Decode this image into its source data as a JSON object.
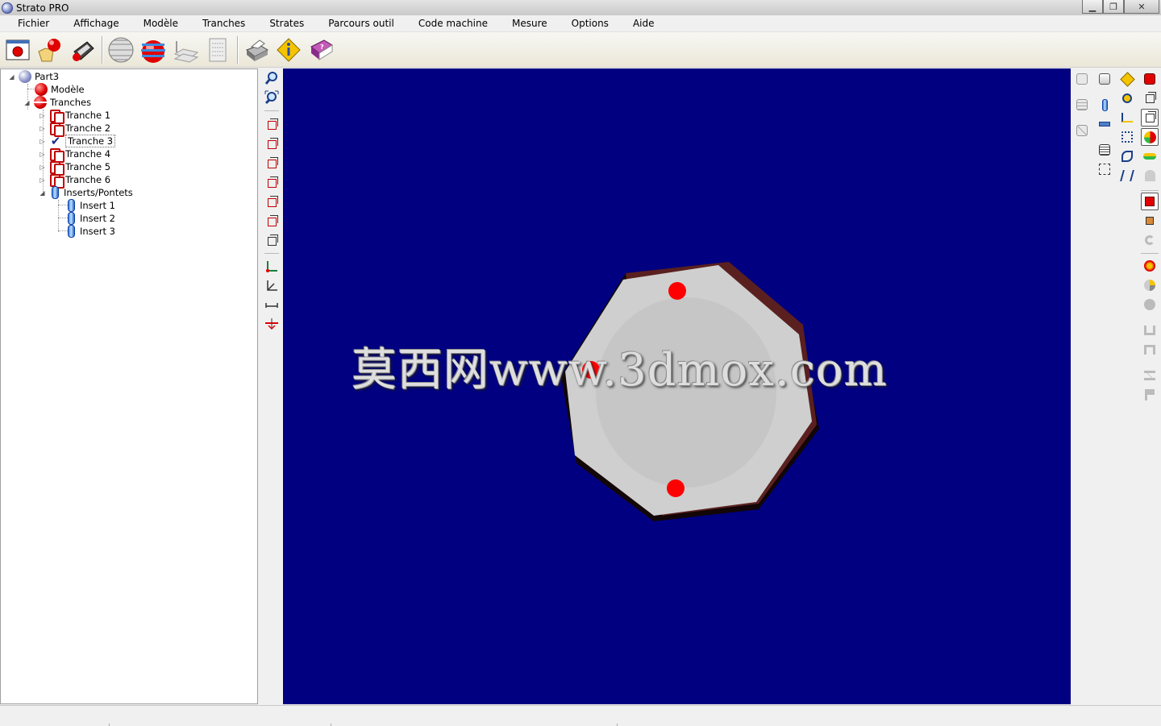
{
  "window": {
    "title": "Strato PRO",
    "controls": [
      "minimize",
      "maximize",
      "close"
    ]
  },
  "menu": [
    "Fichier",
    "Affichage",
    "Modèle",
    "Tranches",
    "Strates",
    "Parcours outil",
    "Code machine",
    "Mesure",
    "Options",
    "Aide"
  ],
  "toolbar": {
    "buttons": [
      "new-part-icon",
      "open-model-icon",
      "save-icon",
      "sphere-wire-icon",
      "stratify-icon",
      "slice-plane-icon",
      "gcode-icon",
      "print-icon",
      "info-icon",
      "help-book-icon"
    ]
  },
  "tree": {
    "root": "Part3",
    "model": "Modèle",
    "slices_folder": "Tranches",
    "slices": [
      "Tranche 1",
      "Tranche 2",
      "Tranche 3",
      "Tranche 4",
      "Tranche 5",
      "Tranche 6"
    ],
    "selected_slice": "Tranche 3",
    "inserts_folder": "Inserts/Pontets",
    "inserts": [
      "Insert 1",
      "Insert 2",
      "Insert 3"
    ]
  },
  "viewport": {
    "background": "#000080",
    "watermark": "莫西网www.3dmox.com",
    "part_color": "#cfcfcf",
    "edge_color": "#5a2020",
    "marker_color": "#ff0000",
    "markers": 3
  },
  "colors": {
    "accent_red": "#e00000",
    "tree_blue": "#1d2c8a"
  }
}
